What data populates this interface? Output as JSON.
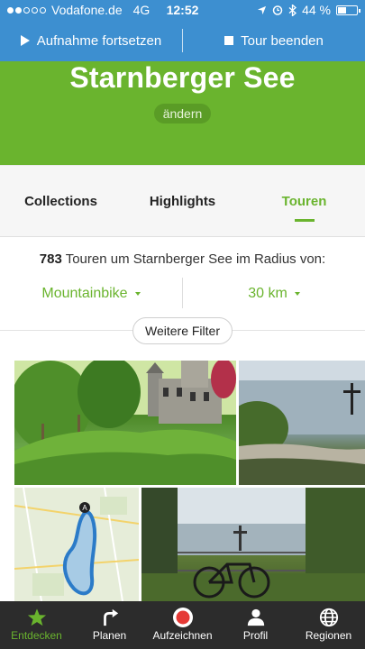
{
  "status": {
    "carrier": "Vodafone.de",
    "network": "4G",
    "time": "12:52",
    "battery": "44 %",
    "battery_level": 0.44
  },
  "recording": {
    "resume_label": "Aufnahme fortsetzen",
    "end_label": "Tour beenden"
  },
  "hero": {
    "title": "Starnberger See",
    "change_label": "ändern"
  },
  "tabs": [
    {
      "label": "Collections",
      "active": false
    },
    {
      "label": "Highlights",
      "active": false
    },
    {
      "label": "Touren",
      "active": true
    }
  ],
  "summary": {
    "count": "783",
    "text": " Touren um Starnberger See im Radius von:"
  },
  "filters": {
    "sport": "Mountainbike",
    "radius": "30 km",
    "more_label": "Weitere Filter"
  },
  "map_marker": "A",
  "colors": {
    "accent_green": "#6ab42e",
    "blue_bar": "#3d8fd0",
    "nav_bg": "#2c2c2c",
    "record_red": "#e53935"
  },
  "nav": [
    {
      "label": "Entdecken",
      "icon": "star-icon",
      "active": true
    },
    {
      "label": "Planen",
      "icon": "turn-arrow-icon",
      "active": false
    },
    {
      "label": "Aufzeichnen",
      "icon": "record-icon",
      "active": false
    },
    {
      "label": "Profil",
      "icon": "person-icon",
      "active": false
    },
    {
      "label": "Regionen",
      "icon": "globe-icon",
      "active": false
    }
  ]
}
